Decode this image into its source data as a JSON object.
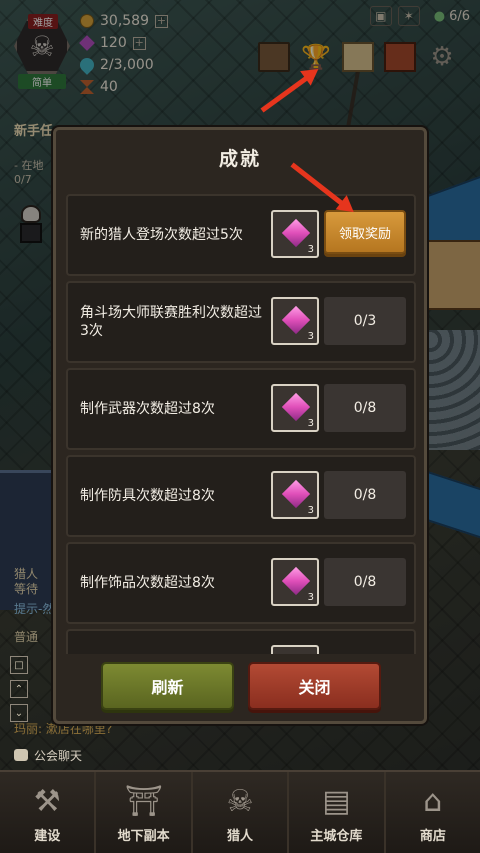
{
  "hud": {
    "difficulty_tag": "难度",
    "difficulty_level": "简单",
    "skull_icon": "skull-icon",
    "resources": [
      {
        "icon": "gold-coin-icon",
        "value": "30,589"
      },
      {
        "icon": "gem-icon",
        "value": "120"
      },
      {
        "icon": "water-drop-icon",
        "value": "2/3,000"
      },
      {
        "icon": "hourglass-icon",
        "value": "40"
      }
    ],
    "population": "6/6"
  },
  "background": {
    "quest_title": "新手任",
    "quest_line": "- 在地",
    "quest_count": "0/7",
    "hunter_tag_1": "猎人",
    "hunter_tag_2": "等待",
    "tip": "提示-然",
    "channel": "普通",
    "chat_label": "公会聊天",
    "chat_line": "玛丽: 漱店在哪里?"
  },
  "modal": {
    "title": "成就",
    "achievements": [
      {
        "text": "新的猎人登场次数超过5次",
        "reward_qty": "3",
        "status": "claim",
        "claim_label": "领取奖励"
      },
      {
        "text": "角斗场大师联赛胜利次数超过3次",
        "reward_qty": "3",
        "status": "progress",
        "progress": "0/3"
      },
      {
        "text": "制作武器次数超过8次",
        "reward_qty": "3",
        "status": "progress",
        "progress": "0/8"
      },
      {
        "text": "制作防具次数超过8次",
        "reward_qty": "3",
        "status": "progress",
        "progress": "0/8"
      },
      {
        "text": "制作饰品次数超过8次",
        "reward_qty": "3",
        "status": "progress",
        "progress": "0/8"
      }
    ],
    "refresh_label": "刷新",
    "close_label": "关闭"
  },
  "bottom_nav": [
    {
      "icon": "hammer-icon",
      "label": "建设"
    },
    {
      "icon": "dungeon-gate-icon",
      "label": "地下副本"
    },
    {
      "icon": "hunter-emblem-icon",
      "label": "猎人"
    },
    {
      "icon": "warehouse-chest-icon",
      "label": "主城仓库"
    },
    {
      "icon": "shop-icon",
      "label": "商店"
    }
  ],
  "colors": {
    "claim_button": "#c98a2c",
    "refresh_button": "#6d7a2a",
    "close_button": "#a13f2b",
    "pointer_arrow": "#e6351d"
  }
}
